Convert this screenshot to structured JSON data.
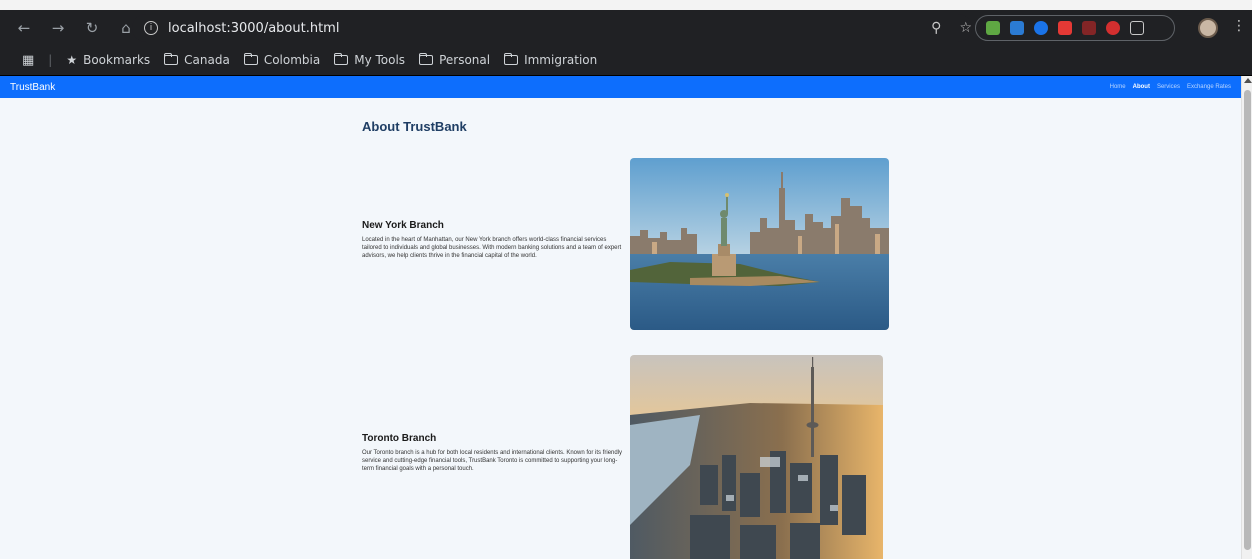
{
  "browser": {
    "url": "localhost:3000/about.html",
    "bookmarks": [
      {
        "label": "Bookmarks",
        "icon": "star-icon"
      },
      {
        "label": "Canada",
        "icon": "folder-icon"
      },
      {
        "label": "Colombia",
        "icon": "folder-icon"
      },
      {
        "label": "My Tools",
        "icon": "folder-icon"
      },
      {
        "label": "Personal",
        "icon": "folder-icon"
      },
      {
        "label": "Immigration",
        "icon": "folder-icon"
      }
    ]
  },
  "site": {
    "brand": "TrustBank",
    "nav": [
      {
        "label": "Home",
        "active": false
      },
      {
        "label": "About",
        "active": true
      },
      {
        "label": "Services",
        "active": false
      },
      {
        "label": "Exchange Rates",
        "active": false
      }
    ],
    "accent_color": "#0d6efd"
  },
  "main": {
    "title": "About TrustBank",
    "branches": [
      {
        "name": "New York Branch",
        "description": "Located in the heart of Manhattan, our New York branch offers world-class financial services tailored to individuals and global businesses. With modern banking solutions and a team of expert advisors, we help clients thrive in the financial capital of the world."
      },
      {
        "name": "Toronto Branch",
        "description": "Our Toronto branch is a hub for both local residents and international clients. Known for its friendly service and cutting-edge financial tools, TrustBank Toronto is committed to supporting your long-term financial goals with a personal touch."
      }
    ]
  }
}
